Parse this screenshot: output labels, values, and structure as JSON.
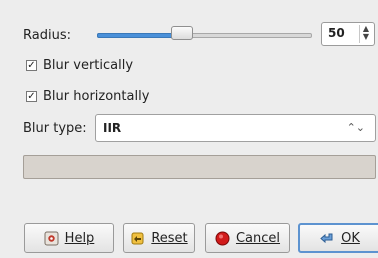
{
  "radius": {
    "label": "Radius:",
    "value": "50",
    "slider_fraction": 0.4
  },
  "checkboxes": {
    "vertical": {
      "label": "Blur vertically",
      "checked": true
    },
    "horizontal": {
      "label": "Blur horizontally",
      "checked": true
    }
  },
  "blur_type": {
    "label": "Blur type:",
    "selected": "IIR"
  },
  "buttons": {
    "help": "Help",
    "reset": "Reset",
    "cancel": "Cancel",
    "ok": "OK"
  },
  "icons": {
    "help": "help-icon",
    "reset": "reset-icon",
    "cancel": "cancel-icon",
    "ok": "ok-icon",
    "spin": "spin-arrows-icon",
    "select": "chevron-updown-icon"
  },
  "colors": {
    "slider_fill": "#4a90d9",
    "progress_bg": "#d8d3cd",
    "ok_border": "#5d93d0",
    "cancel_icon": "#d11a1a"
  }
}
